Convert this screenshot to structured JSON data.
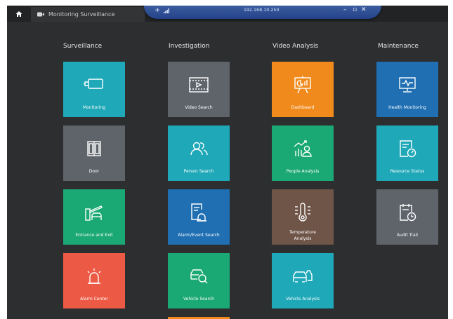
{
  "header": {
    "tab_label": "Monitoring Surveillance",
    "remote_ip": "192.168.10.250",
    "controls": {
      "minimize": "–",
      "restore": "▫",
      "close": "✕"
    }
  },
  "columns": [
    {
      "title": "Surveillance"
    },
    {
      "title": "Investigation"
    },
    {
      "title": "Video Analysis"
    },
    {
      "title": "Maintenance"
    }
  ],
  "tiles": {
    "monitoring": {
      "label": "Monitoring",
      "color": "#1fa8b8"
    },
    "door": {
      "label": "Door",
      "color": "#5f636a"
    },
    "entrance_exit": {
      "label": "Entrance and Exit",
      "color": "#1aa874"
    },
    "alarm_center": {
      "label": "Alarm Center",
      "color": "#ec5a45"
    },
    "video_search": {
      "label": "Video Search",
      "color": "#5f636a"
    },
    "person_search": {
      "label": "Person Search",
      "color": "#1fa8b8"
    },
    "alarm_event_search": {
      "label": "Alarm/Event Search",
      "color": "#1f6fb2"
    },
    "vehicle_search": {
      "label": "Vehicle Search",
      "color": "#1aa874"
    },
    "dashboard": {
      "label": "Dashboard",
      "color": "#f08a1c"
    },
    "people_analysis": {
      "label": "People Analysis",
      "color": "#1aa874"
    },
    "temperature_analysis": {
      "label": "Temperature Analysis",
      "color": "#6f5448"
    },
    "vehicle_analysis": {
      "label": "Vehicle Analysis",
      "color": "#1fa8b8"
    },
    "health_monitoring": {
      "label": "Health Monitoring",
      "color": "#1f6fb2"
    },
    "resource_status": {
      "label": "Resource Status",
      "color": "#1fa8b8"
    },
    "audit_trail": {
      "label": "Audit Trail",
      "color": "#5f636a"
    },
    "partial": {
      "color": "#f08a1c"
    }
  }
}
